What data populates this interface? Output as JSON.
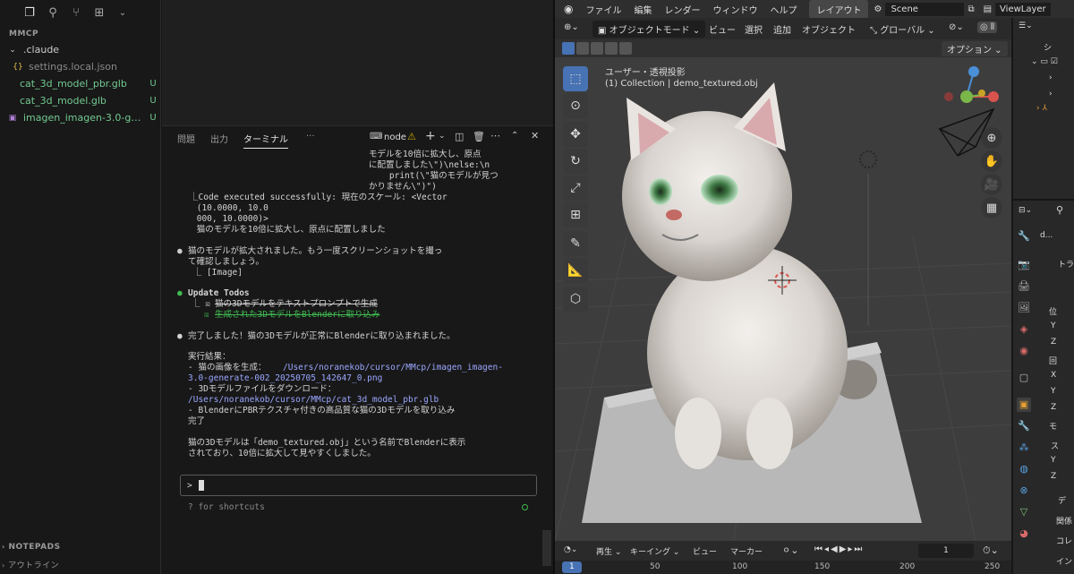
{
  "vscode": {
    "activity_icons": [
      "files-icon",
      "search-icon",
      "source-control-icon",
      "extensions-icon",
      "chevron-down-icon"
    ],
    "explorer_title": "MMCP",
    "tree": [
      {
        "label": ".claude",
        "type": "folder",
        "git": ""
      },
      {
        "label": "settings.local.json",
        "type": "json",
        "git": ""
      },
      {
        "label": "cat_3d_model_pbr.glb",
        "type": "file",
        "git": "U"
      },
      {
        "label": "cat_3d_model.glb",
        "type": "file",
        "git": "U"
      },
      {
        "label": "imagen_imagen-3.0-ge...",
        "type": "image",
        "git": "U"
      }
    ],
    "bottom_sections": [
      "NOTEPADS",
      "アウトライン"
    ]
  },
  "panel": {
    "tabs": [
      "問題",
      "出力",
      "ターミナル",
      "···"
    ],
    "active_tab": "ターミナル",
    "terminal_name": "node",
    "lines": {
      "l1": "モデルを10倍に拡大し、原点",
      "l2": "に配置しました\\\")\\nelse:\\n",
      "l3": "    print(\\\"猫のモデルが見つ",
      "l4": "かりません\\\")\")",
      "l5": "⎿Code executed successfully: 現在のスケール: <Vector",
      "l6": " (10.0000, 10.0",
      "l7": " 000, 10.0000)>",
      "l8": " 猫のモデルを10倍に拡大し、原点に配置しました",
      "l9": "猫のモデルが拡大されました。もう一度スクリーンショットを撮っ",
      "l10": "て確認しましょう。",
      "l11": " ⎿ [Image]",
      "todo_title": "Update Todos",
      "todo1": "猫の3Dモデルをテキストプロンプトで生成",
      "todo2": "生成された3DモデルをBlenderに取り込み",
      "done1": "完了しました！猫の3Dモデルが正常にBlenderに取り込まれました。",
      "r_title": "実行結果：",
      "r1a": "- 猫の画像を生成：",
      "r1b": "/Users/noranekob/cursor/MMcp/imagen_imagen-",
      "r1c": "3.0-generate-002_20250705_142647_0.png",
      "r2a": "- 3Dモデルファイルをダウンロード：",
      "r2b": "/Users/noranekob/cursor/MMcp/cat_3d_model_pbr.glb",
      "r3a": "- BlenderにPBRテクスチャ付きの高品質な猫の3Dモデルを取り込み",
      "r3b": "完了",
      "s1": "猫の3Dモデルは「demo_textured.obj」という名前でBlenderに表示",
      "s2": "されており、10倍に拡大して見やすくしました。"
    },
    "prompt": ">",
    "hint": "? for shortcuts"
  },
  "blender": {
    "menus": [
      "ファイル",
      "編集",
      "レンダー",
      "ウィンドウ",
      "ヘルプ"
    ],
    "workspace_tab": "レイアウト",
    "scene": "Scene",
    "view_layer": "ViewLayer",
    "mode": "オブジェクトモード",
    "header_menus": [
      "ビュー",
      "選択",
      "追加",
      "オブジェクト"
    ],
    "transform": "グローバル",
    "options": "オプション",
    "view_label": "ユーザー・透視投影",
    "collection_label": "(1) Collection | demo_textured.obj",
    "timeline": {
      "playback": "再生",
      "keying": "キーイング",
      "view": "ビュー",
      "marker": "マーカー",
      "current_frame": "1",
      "ticks": [
        "1",
        "50",
        "100",
        "150",
        "200",
        "250"
      ]
    },
    "outliner_label": "シ",
    "props": {
      "name_short": "d...",
      "section": "トラ",
      "labels": [
        "位",
        "Y",
        "Z",
        "回",
        "X",
        "Y",
        "Z",
        "モ",
        "ス",
        "Y",
        "Z"
      ],
      "bottom": [
        "デ",
        "関係",
        "コレ",
        "イン"
      ]
    },
    "accent_color": "#4772b3"
  }
}
